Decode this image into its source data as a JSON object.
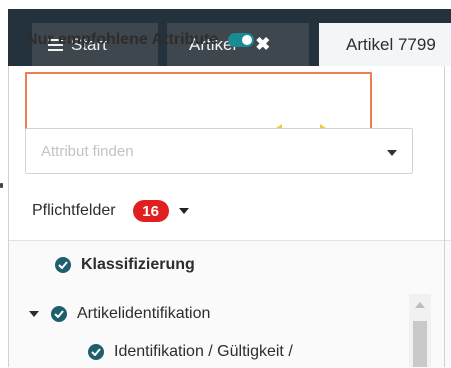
{
  "tabs": {
    "start_label": "Start",
    "artikel_label": "Artikel",
    "artikel_active_label": "Artikel 7799"
  },
  "filter": {
    "toggle_label": "Nur empfohlene Attribute",
    "toggle_state": "on",
    "search_placeholder": "Attribut finden",
    "required_label": "Pflichtfelder",
    "required_count": "16"
  },
  "tree": {
    "items": [
      {
        "label": "Klassifizierung"
      },
      {
        "label": "Artikelidentifikation"
      },
      {
        "label": "Identifikation / Gültigkeit /"
      }
    ]
  },
  "colors": {
    "tabbar": "#23323c",
    "toggle_accent": "#1a8a93",
    "highlight": "#ee7e52",
    "arrow": "#f5c842",
    "badge": "#e11f1f",
    "check_icon": "#1e5f6d"
  },
  "icons": {
    "menu": "hamburger-icon",
    "close": "close-icon",
    "toggle": "toggle-switch-icon",
    "resize": "double-arrow-icon",
    "check": "check-circle-icon",
    "dropdown": "caret-down-icon"
  }
}
